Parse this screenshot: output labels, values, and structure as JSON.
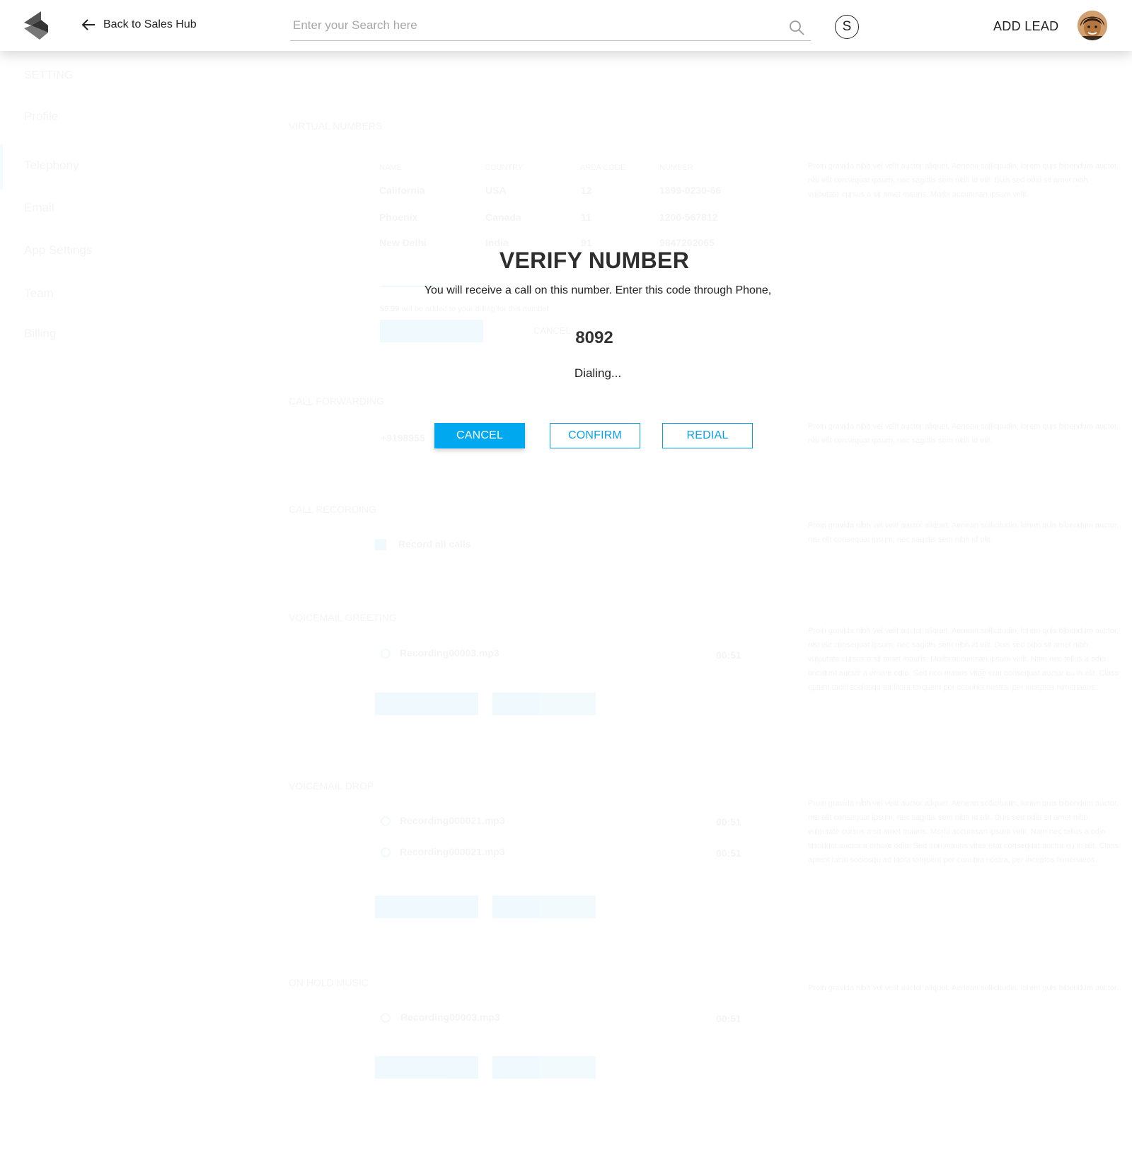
{
  "header": {
    "back_label": "Back to Sales Hub",
    "search_placeholder": "Enter your Search here",
    "s_badge": "S",
    "add_lead_label": "ADD LEAD"
  },
  "sidebar": {
    "title": "SETTING",
    "items": [
      {
        "label": "Profile"
      },
      {
        "label": "Telephony",
        "active": true
      },
      {
        "label": "Email"
      },
      {
        "label": "App Settings"
      },
      {
        "label": "Team"
      },
      {
        "label": "Billing"
      }
    ]
  },
  "sections": {
    "virtual_numbers": {
      "title": "VIRTUAL NUMBERS",
      "columns": [
        "NAME",
        "COUNTRY",
        "AREA CODE",
        "NUMBER"
      ],
      "rows": [
        [
          "California",
          "USA",
          "12",
          "1899-0230-66"
        ],
        [
          "Phoenix",
          "Canada",
          "11",
          "1200-567812"
        ],
        [
          "New Delhi",
          "India",
          "91",
          "9847202065"
        ]
      ],
      "billing_amount": "$9.99",
      "billing_note": "will be added to your billing for this number",
      "save_label": "SAVE",
      "cancel_label": "CANCEL"
    },
    "call_forwarding": {
      "title": "CALL FORWARDING",
      "number": "+9198955"
    },
    "call_recording": {
      "title": "CALL RECORDING",
      "option": "Record all calls"
    },
    "voicemail_greeting": {
      "title": "VOICEMAIL GREETING",
      "files": [
        {
          "name": "Recording00003.mp3",
          "duration": "00:51"
        }
      ],
      "upload_label": "UPLOAD FILE",
      "record_label": "RECORD FROM CALL"
    },
    "voicemail_drop": {
      "title": "VOICEMAIL DROP",
      "files": [
        {
          "name": "Recording000021.mp3",
          "duration": "00:51"
        },
        {
          "name": "Recording000021.mp3",
          "duration": "00:51"
        }
      ],
      "upload_label": "UPLOAD FILE",
      "record_label": "RECORD FROM CALL"
    },
    "on_hold_music": {
      "title": "ON HOLD MUSIC",
      "files": [
        {
          "name": "Recording00003.mp3",
          "duration": "00:51"
        }
      ],
      "upload_label": "UPLOAD FILE",
      "record_label": "RECORD FROM CALL"
    },
    "descriptions": {
      "short": "Proin gravida nibh vel velit auctor aliquet. Aenean sollicitudin, lorem quis bibendum auctor, nisi elit consequat ipsum, nec sagittis sem nibh id elit.",
      "medium": "Proin gravida nibh vel velit auctor aliquet. Aenean sollicitudin, lorem quis bibendum auctor, nisi elit consequat ipsum, nec sagittis sem nibh id elit. Duis sed odio sit amet nibh vulputate cursus a sit amet mauris. Morbi accumsan ipsum velit.",
      "long": "Proin gravida nibh vel velit auctor aliquet. Aenean sollicitudin, lorem quis bibendum auctor, nisi elit consequat ipsum, nec sagittis sem nibh id elit. Duis sed odio sit amet nibh vulputate cursus a sit amet mauris. Morbi accumsan ipsum velit. Nam nec tellus a odio tincidunt auctor a ornare odio. Sed non mauris vitae erat consequat auctor eu in elit. Class aptent taciti sociosqu ad litora torquent per conubia nostra, per inceptos himenaeos.",
      "tiny": "Proin gravida nibh vel velit auctor aliquet. Aenean sollicitudin, lorem quis bibendum auctor."
    }
  },
  "modal": {
    "title": "VERIFY NUMBER",
    "subtitle": "You will receive a call on this number. Enter this code through Phone,",
    "code": "8092",
    "status": "Dialing...",
    "cancel_label": "CANCEL",
    "confirm_label": "CONFIRM",
    "redial_label": "REDIAL"
  },
  "colors": {
    "accent": "#00a8f0",
    "text_dark": "#2e2e2e"
  },
  "icons": {
    "logo": "brand-logo-icon",
    "back": "arrow-left-icon",
    "search": "search-icon",
    "edit": "pencil-icon",
    "play": "play-icon"
  }
}
